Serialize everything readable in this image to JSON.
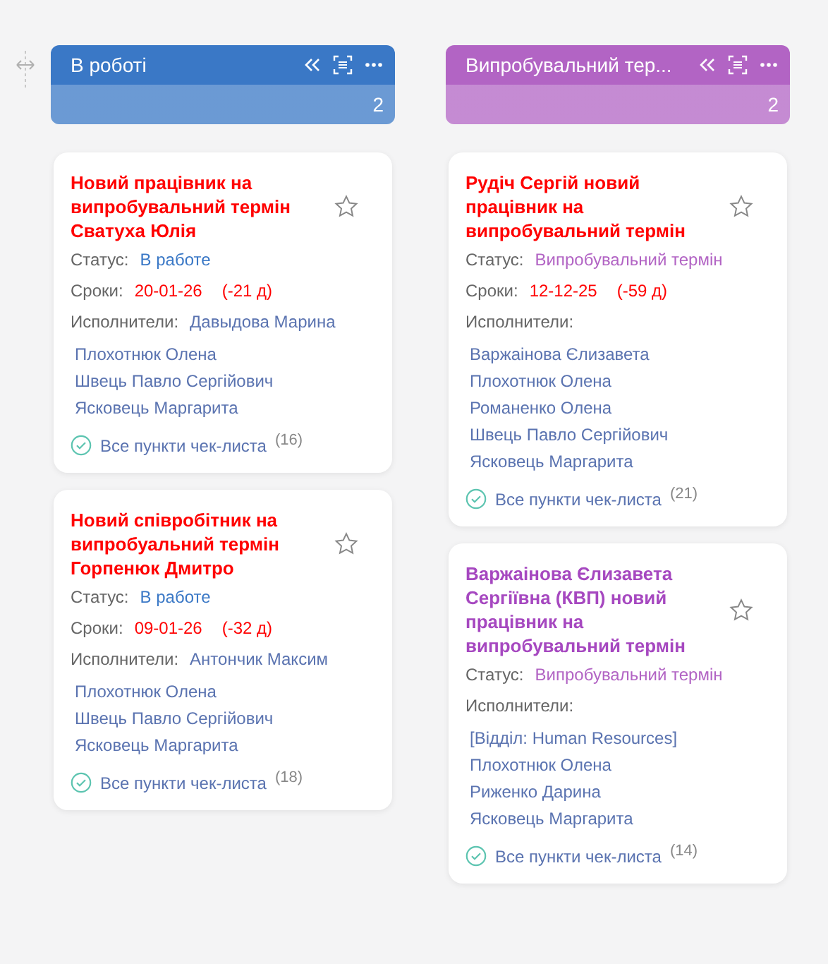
{
  "columns": [
    {
      "title": "В роботі",
      "count": "2",
      "color": "#3a78c6",
      "cards": [
        {
          "title": "Новий працівник на випробувальний термін Сватуха Юлія",
          "color": "#ff0000",
          "status_label": "Статус:",
          "status": "В работе",
          "deadline_label": "Сроки:",
          "deadline": "20-01-26",
          "overdue": "(-21 д)",
          "assignees_label": "Исполнители:",
          "assignee_inline": "Давыдова Марина",
          "assignees": [
            "Плохотнюк Олена",
            "Швець Павло Сергійович",
            "Ясковець Маргарита"
          ],
          "checklist": "Все пункти чек-листа",
          "checklist_count": "(16)"
        },
        {
          "title": "Новий співробітник на випробуальний термін Горпенюк Дмитро",
          "color": "#ff0000",
          "status_label": "Статус:",
          "status": "В работе",
          "deadline_label": "Сроки:",
          "deadline": "09-01-26",
          "overdue": "(-32 д)",
          "assignees_label": "Исполнители:",
          "assignee_inline": "Антончик Максим",
          "assignees": [
            "Плохотнюк Олена",
            "Швець Павло Сергійович",
            "Ясковець Маргарита"
          ],
          "checklist": "Все пункти чек-листа",
          "checklist_count": "(18)"
        }
      ]
    },
    {
      "title": "Випробувальний тер...",
      "count": "2",
      "color": "#b264c4",
      "cards": [
        {
          "title": "Рудіч Сергій новий працівник на випробувальний термін",
          "color": "#ff0000",
          "status_label": "Статус:",
          "status": "Випробувальний термін",
          "deadline_label": "Сроки:",
          "deadline": "12-12-25",
          "overdue": "(-59 д)",
          "assignees_label": "Исполнители:",
          "assignees": [
            "Варжаінова Єлизавета",
            "Плохотнюк Олена",
            "Романенко Олена",
            "Швець Павло Сергійович",
            "Ясковець Маргарита"
          ],
          "checklist": "Все пункти чек-листа",
          "checklist_count": "(21)"
        },
        {
          "title": "Варжаінова Єлизавета Сергіївна (КВП) новий працівник на випробувальний термін",
          "color": "#a648c0",
          "status_label": "Статус:",
          "status": "Випробувальний термін",
          "assignees_label": "Исполнители:",
          "assignees": [
            "[Відділ: Human Resources]",
            "Плохотнюк Олена",
            "Риженко Дарина",
            "Ясковець Маргарита"
          ],
          "checklist": "Все пункти чек-листа",
          "checklist_count": "(14)"
        }
      ]
    }
  ]
}
